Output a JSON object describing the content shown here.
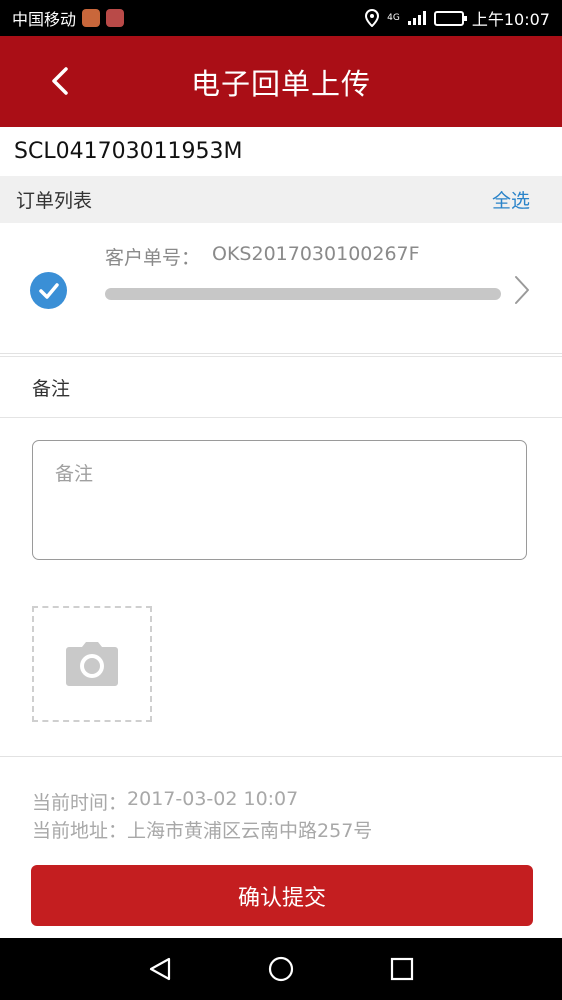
{
  "status_bar": {
    "carrier": "中国移动",
    "network": "4G",
    "time": "上午10:07"
  },
  "header": {
    "title": "电子回单上传"
  },
  "shipment": {
    "number": "SCL041703011953M"
  },
  "order_list": {
    "title": "订单列表",
    "select_all": "全选",
    "items": [
      {
        "label": "客户单号：",
        "number": "OKS2017030100267F",
        "checked": true,
        "progress": 1.0
      }
    ]
  },
  "remark": {
    "title": "备注",
    "placeholder": "备注"
  },
  "info": {
    "time_label": "当前时间：",
    "time_value": "2017-03-02 10:07",
    "address_label": "当前地址：",
    "address_value": "上海市黄浦区云南中路257号"
  },
  "submit": {
    "label": "确认提交"
  },
  "colors": {
    "brand": "#aa0e16",
    "button": "#c41e20",
    "link": "#2a83c9",
    "check": "#3a8fd6"
  },
  "icons": {
    "back": "back-arrow-icon",
    "check": "check-circle-icon",
    "chevron": "chevron-right-icon",
    "camera": "camera-icon",
    "nav_back": "nav-back-icon",
    "nav_home": "nav-home-icon",
    "nav_recent": "nav-recent-icon"
  }
}
